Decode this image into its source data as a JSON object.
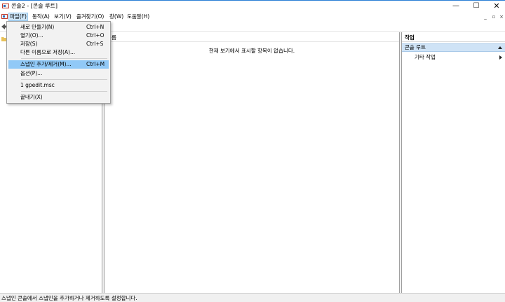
{
  "window": {
    "title": "콘솔2 - [콘솔 루트]",
    "controls": {
      "minimize": "—",
      "maximize": "☐",
      "close": "✕"
    }
  },
  "menubar": {
    "items": [
      "파일(F)",
      "동작(A)",
      "보기(V)",
      "즐겨찾기(O)",
      "창(W)",
      "도움말(H)"
    ],
    "mdi_controls": [
      "_",
      "▫",
      "×"
    ]
  },
  "file_menu": {
    "items": [
      {
        "label": "새로 만들기(N)",
        "shortcut": "Ctrl+N"
      },
      {
        "label": "열기(O)...",
        "shortcut": "Ctrl+O"
      },
      {
        "label": "저장(S)",
        "shortcut": "Ctrl+S"
      },
      {
        "label": "다른 이름으로 저장(A)...",
        "shortcut": ""
      },
      {
        "label": "스냅인 추가/제거(M)...",
        "shortcut": "Ctrl+M"
      },
      {
        "label": "옵션(P)...",
        "shortcut": ""
      },
      {
        "label": "1 gpedit.msc",
        "shortcut": ""
      },
      {
        "label": "끝내기(X)",
        "shortcut": ""
      }
    ]
  },
  "center": {
    "column_header": "름",
    "empty_message": "현재 보기에서 표시할 항목이 없습니다."
  },
  "actions": {
    "title": "작업",
    "section": "콘솔 루트",
    "item": "기타 작업"
  },
  "status": {
    "text": "스냅인 콘솔에서 스냅인을 추가하거나 제거하도록 설정합니다."
  },
  "colors": {
    "highlight": "#91c9f7",
    "menu_open": "#cce4f7",
    "actions_section": "#cfe3f6",
    "titlebar_accent": "#2b7fd6"
  }
}
